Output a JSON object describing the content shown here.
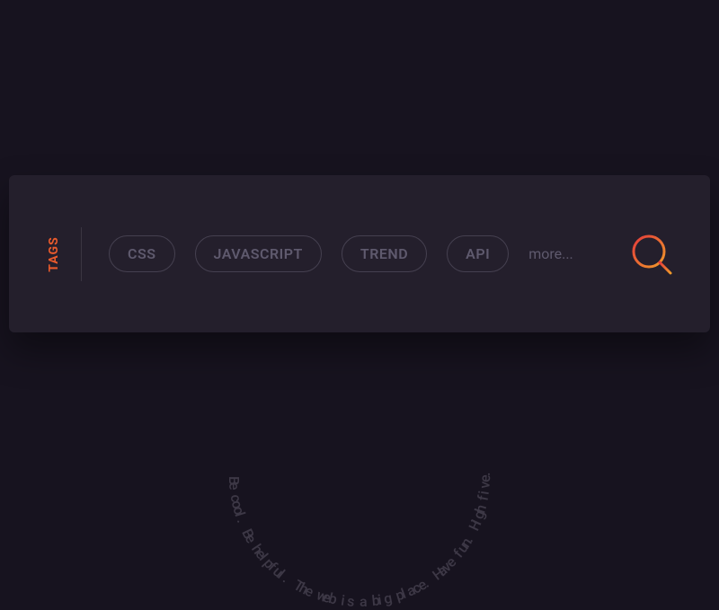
{
  "card": {
    "label": "TAGS",
    "tags": [
      "CSS",
      "JAVASCRIPT",
      "TREND",
      "API"
    ],
    "more": "more..."
  },
  "circle_text": "Be cool. Be helpful. The web is a big place. Have fun. High five.",
  "colors": {
    "accent": "#e85a2c",
    "search_gradient": [
      "#e43b3b",
      "#f09a2a"
    ]
  }
}
